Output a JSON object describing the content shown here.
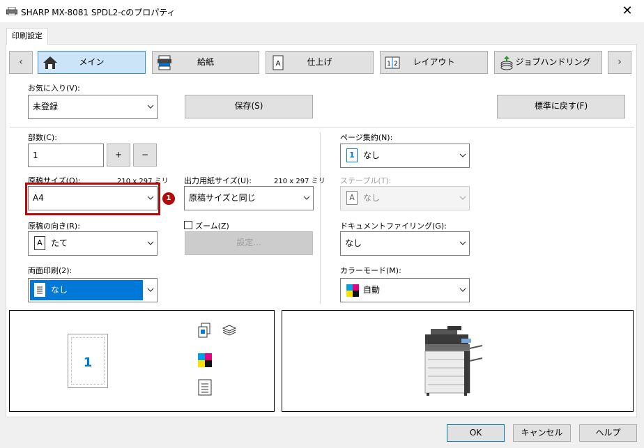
{
  "window": {
    "title": "SHARP MX-8081 SPDL2-cのプロパティ",
    "close": "✕"
  },
  "tab": {
    "label": "印刷設定"
  },
  "nav": {
    "prev": "‹",
    "next": "›",
    "items": [
      {
        "label": "メイン",
        "icon": "home-icon",
        "active": true
      },
      {
        "label": "給紙",
        "icon": "paper-tray-icon",
        "active": false
      },
      {
        "label": "仕上げ",
        "icon": "finishing-icon",
        "active": false
      },
      {
        "label": "レイアウト",
        "icon": "layout-icon",
        "active": false
      },
      {
        "label": "ジョブハンドリング",
        "icon": "job-handling-icon",
        "active": false
      }
    ]
  },
  "favorites": {
    "label": "お気に入り(V):",
    "value": "未登録",
    "save": "保存(S)",
    "reset": "標準に戻す(F)"
  },
  "copies": {
    "label": "部数(C):",
    "value": "1",
    "plus": "+",
    "minus": "−"
  },
  "original_size": {
    "label": "原稿サイズ(O):",
    "dims": "210 x 297 ミリ",
    "value": "A4",
    "badge": "1"
  },
  "output_size": {
    "label": "出力用紙サイズ(U):",
    "dims": "210 x 297 ミリ",
    "value": "原稿サイズと同じ"
  },
  "orientation": {
    "label": "原稿の向き(R):",
    "icon_letter": "A",
    "value": "たて"
  },
  "zoom": {
    "label": "ズーム(Z)",
    "settings": "設定..."
  },
  "duplex": {
    "label": "両面印刷(2):",
    "value": "なし"
  },
  "n_up": {
    "label": "ページ集約(N):",
    "icon_number": "1",
    "value": "なし"
  },
  "staple": {
    "label": "ステープル(T):",
    "icon_letter": "A",
    "value": "なし"
  },
  "doc_filing": {
    "label": "ドキュメントファイリング(G):",
    "value": "なし"
  },
  "color_mode": {
    "label": "カラーモード(M):",
    "value": "自動"
  },
  "preview": {
    "page_number": "1"
  },
  "footer": {
    "ok": "OK",
    "cancel": "キャンセル",
    "help": "ヘルプ"
  },
  "colors": {
    "accent": "#0078d7",
    "highlight": "#b40a0a",
    "active_tab": "#cce4f7"
  }
}
